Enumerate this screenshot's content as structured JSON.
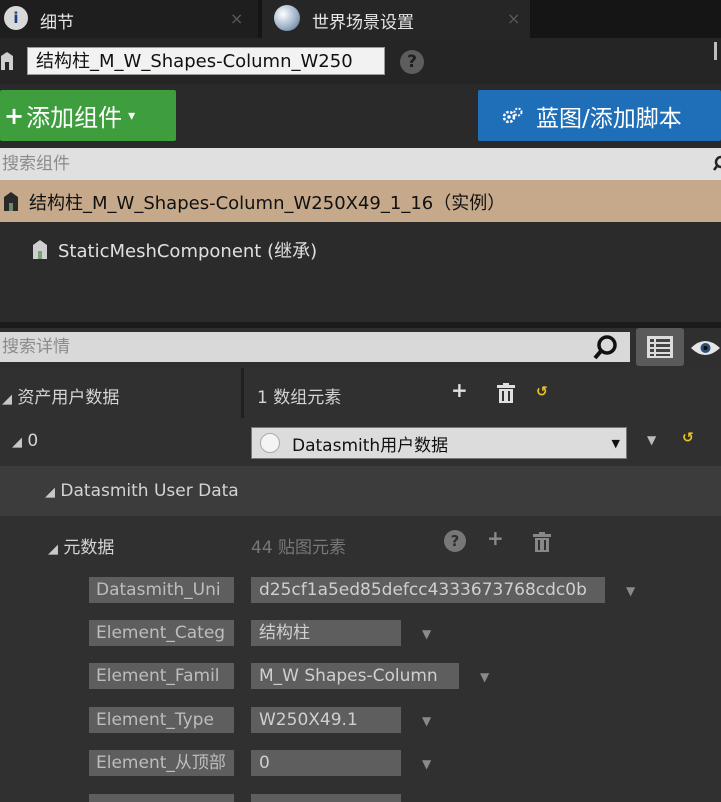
{
  "tabs": [
    {
      "label": "细节",
      "icon": "info-icon",
      "close": "×"
    },
    {
      "label": "世界场景设置",
      "icon": "globe-icon",
      "close": "×"
    }
  ],
  "actor": {
    "name": "结构柱_M_W_Shapes-Column_W250",
    "help_glyph": "?"
  },
  "toolbar": {
    "add_component_label": "添加组件",
    "add_component_plus": "+",
    "add_component_caret": "▾",
    "blueprint_label": "蓝图/添加脚本"
  },
  "component_search": {
    "placeholder": "搜索组件"
  },
  "component_tree": {
    "root": "结构柱_M_W_Shapes-Column_W250X49_1_16（实例）",
    "child": "StaticMeshComponent (继承)"
  },
  "details_search": {
    "placeholder": "搜索详情"
  },
  "properties": {
    "asset_user_data": {
      "label": "资产用户数据",
      "value": "1 数组元素",
      "index_label": "0",
      "combo_value": "Datasmith用户数据"
    },
    "datasmith_user_data": {
      "label": "Datasmith User Data"
    },
    "metadata": {
      "label": "元数据",
      "value": "44 贴图元素",
      "entries": [
        {
          "key": "Datasmith_Uni",
          "value": "d25cf1a5ed85defcc4333673768cdc0b"
        },
        {
          "key": "Element_Categ",
          "value": "结构柱"
        },
        {
          "key": "Element_Famil",
          "value": "M_W Shapes-Column"
        },
        {
          "key": "Element_Type",
          "value": "W250X49.1"
        },
        {
          "key": "Element_从顶部",
          "value": "0"
        }
      ]
    }
  },
  "colors": {
    "add_button": "#3e9e3e",
    "blueprint_button": "#1f6fb8",
    "selected_row": "#c5a98a",
    "reset_arrow": "#e8c62a"
  }
}
